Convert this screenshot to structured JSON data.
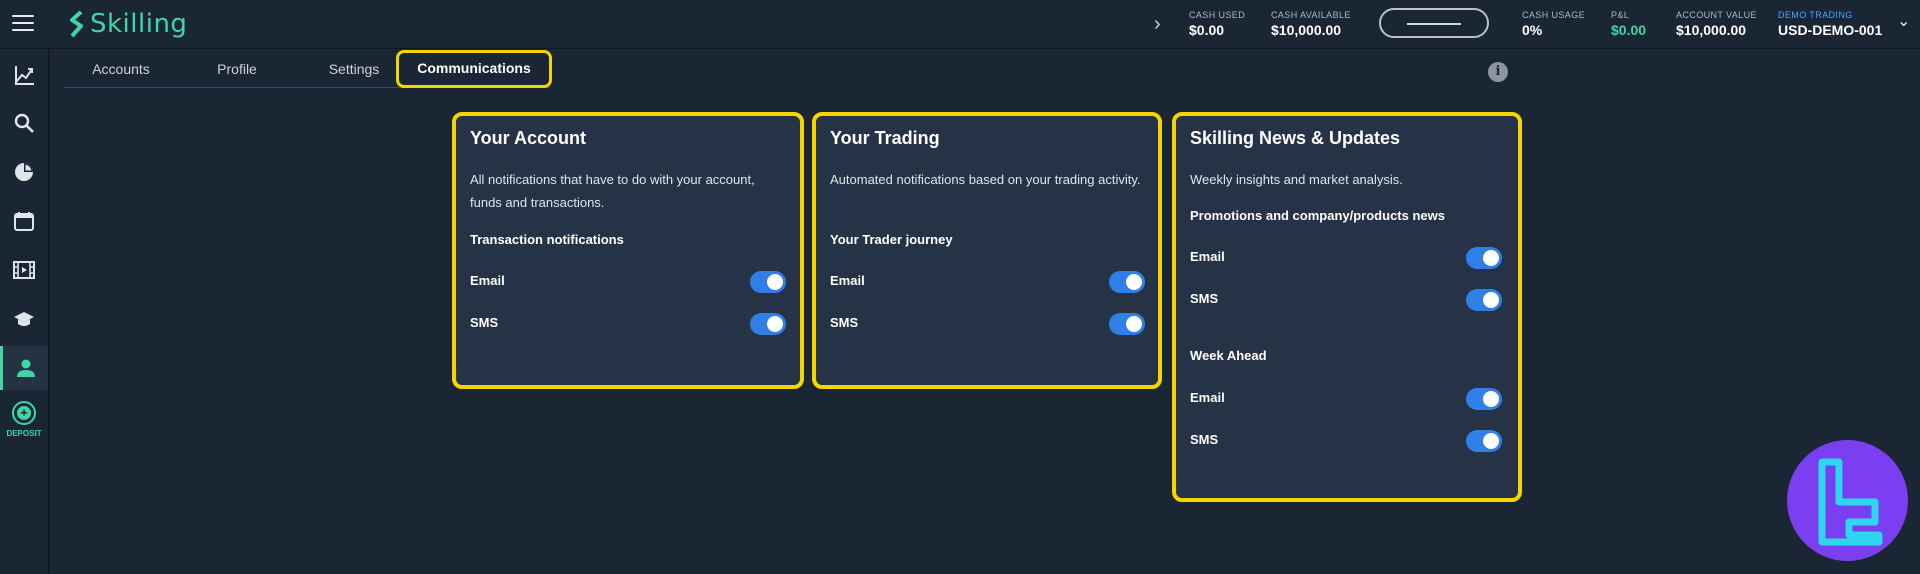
{
  "app": {
    "logo_text": "Skilling"
  },
  "topbar": {
    "stats": [
      {
        "label": "CASH USED",
        "value": "$0.00"
      },
      {
        "label": "CASH AVAILABLE",
        "value": "$10,000.00"
      },
      {
        "label": "CASH USAGE",
        "value": "0%"
      },
      {
        "label": "P&L",
        "value": "$0.00",
        "color": "#3fd5a5"
      },
      {
        "label": "ACCOUNT VALUE",
        "value": "$10,000.00"
      },
      {
        "label": "DEMO TRADING",
        "value": "USD-DEMO-001",
        "label_color": "#4da3ff"
      }
    ]
  },
  "sidebar": {
    "items": [
      "chart-icon",
      "search-icon",
      "pie-chart-icon",
      "calendar-icon",
      "video-icon",
      "education-icon",
      "user-icon"
    ],
    "deposit_label": "DEPOSIT"
  },
  "tabs": [
    {
      "label": "Accounts"
    },
    {
      "label": "Profile"
    },
    {
      "label": "Settings"
    },
    {
      "label": "Communications",
      "active": true
    }
  ],
  "cards": [
    {
      "title": "Your Account",
      "description": "All notifications that have to do with your account, funds and transactions.",
      "sections": [
        {
          "title": "Transaction notifications",
          "rows": [
            {
              "label": "Email",
              "on": true
            },
            {
              "label": "SMS",
              "on": true
            }
          ]
        }
      ]
    },
    {
      "title": "Your Trading",
      "description": "Automated notifications based on your trading activity.",
      "sections": [
        {
          "title": "Your Trader journey",
          "rows": [
            {
              "label": "Email",
              "on": true
            },
            {
              "label": "SMS",
              "on": true
            }
          ]
        }
      ]
    },
    {
      "title": "Skilling News & Updates",
      "description": "Weekly insights and market analysis.",
      "sections": [
        {
          "title": "Promotions and company/products news",
          "rows": [
            {
              "label": "Email",
              "on": true
            },
            {
              "label": "SMS",
              "on": true
            }
          ]
        },
        {
          "title": "Week Ahead",
          "rows": [
            {
              "label": "Email",
              "on": true
            },
            {
              "label": "SMS",
              "on": true
            }
          ]
        }
      ]
    }
  ],
  "colors": {
    "accent": "#3fd5a5",
    "highlight": "#f6d400",
    "toggle_on": "#2f7fe6",
    "background": "#1b2635",
    "card": "#263346"
  }
}
